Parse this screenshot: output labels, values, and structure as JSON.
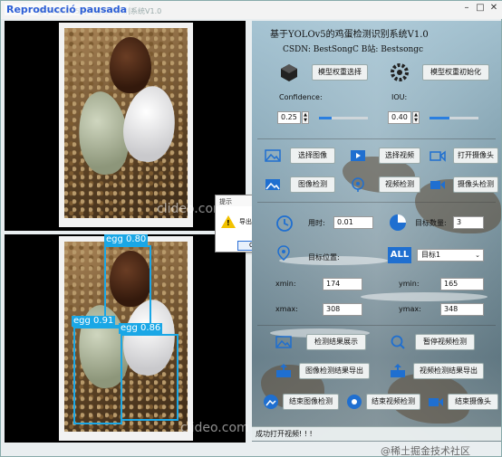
{
  "window": {
    "overlay_title": "Reproducció pausada",
    "title": "基于YOLOv5的鸡蛋检测识别系统V1.0",
    "controls": [
      "–",
      "□",
      "✕"
    ]
  },
  "left": {
    "watermark": "clideo.com",
    "detections": [
      {
        "label": "egg 0.80"
      },
      {
        "label": "egg 0.91"
      },
      {
        "label": "egg 0.86"
      }
    ]
  },
  "dialog": {
    "title": "提示",
    "close": "✕",
    "message": "导出成功!",
    "ok": "OK"
  },
  "panel": {
    "heading": "基于YOLOv5的鸡蛋检测识别系统V1.0",
    "csdn_line": "CSDN:  BestSongC   B站: Bestsongc",
    "model_select": "模型权重选择",
    "model_init": "模型权重初始化",
    "confidence_label": "Confidence:",
    "iou_label": "IOU:",
    "confidence_value": "0.25",
    "iou_value": "0.40",
    "confidence_level": 0.25,
    "iou_level": 0.4,
    "select_image": "选择图像",
    "select_video": "选择视频",
    "open_camera": "打开摄像头",
    "image_detect": "图像检测",
    "video_detect": "视频检测",
    "camera_detect": "摄像头检测",
    "time_label": "用时:",
    "time_value": "0.01",
    "count_label": "目标数量:",
    "count_value": "3",
    "position_label": "目标位置:",
    "target_select": "目标1",
    "xmin_label": "xmin:",
    "xmin_value": "174",
    "ymin_label": "ymin:",
    "ymin_value": "165",
    "xmax_label": "xmax:",
    "xmax_value": "308",
    "ymax_label": "ymax:",
    "ymax_value": "348",
    "show_result": "检测结果展示",
    "pause_video": "暂停视频检测",
    "export_image": "图像检测结果导出",
    "export_video": "视频检测结果导出",
    "end_image": "结束图像检测",
    "end_video": "结束视频检测",
    "end_camera": "结束摄像头",
    "all_badge": "ALL"
  },
  "status": "成功打开视频! ! !",
  "footer_credit": "@稀土掘金技术社区",
  "colors": {
    "detection_box": "#1aa7e6",
    "accent_blue": "#2a7fe0"
  }
}
